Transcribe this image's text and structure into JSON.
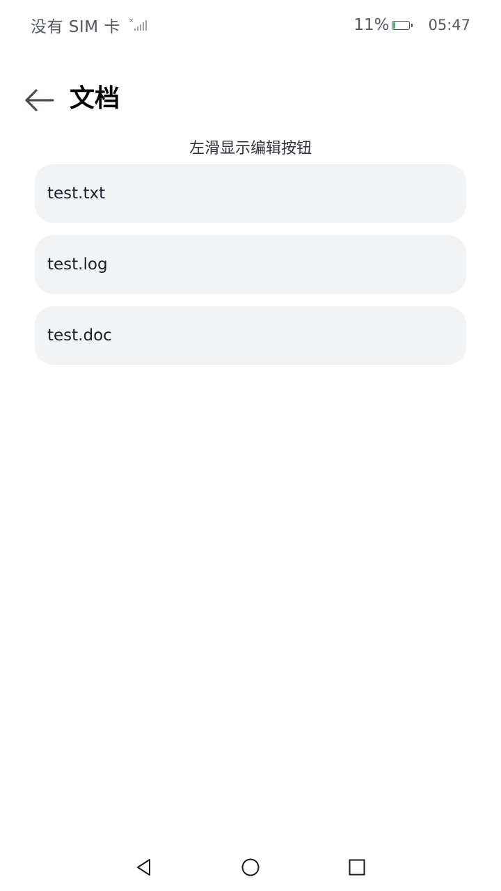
{
  "status_bar": {
    "carrier": "没有 SIM 卡",
    "signal_icon": "no-signal-icon",
    "battery_percent": "11%",
    "battery_level": 0.11,
    "battery_color": "#35c15a",
    "time": "05:47"
  },
  "header": {
    "back_icon": "arrow-left-icon",
    "title": "文档"
  },
  "hint": "左滑显示编辑按钮",
  "files": [
    {
      "name": "test.txt"
    },
    {
      "name": "test.log"
    },
    {
      "name": "test.doc"
    }
  ],
  "nav_bar": {
    "back_icon": "triangle-back-icon",
    "home_icon": "circle-home-icon",
    "recents_icon": "square-recents-icon"
  }
}
